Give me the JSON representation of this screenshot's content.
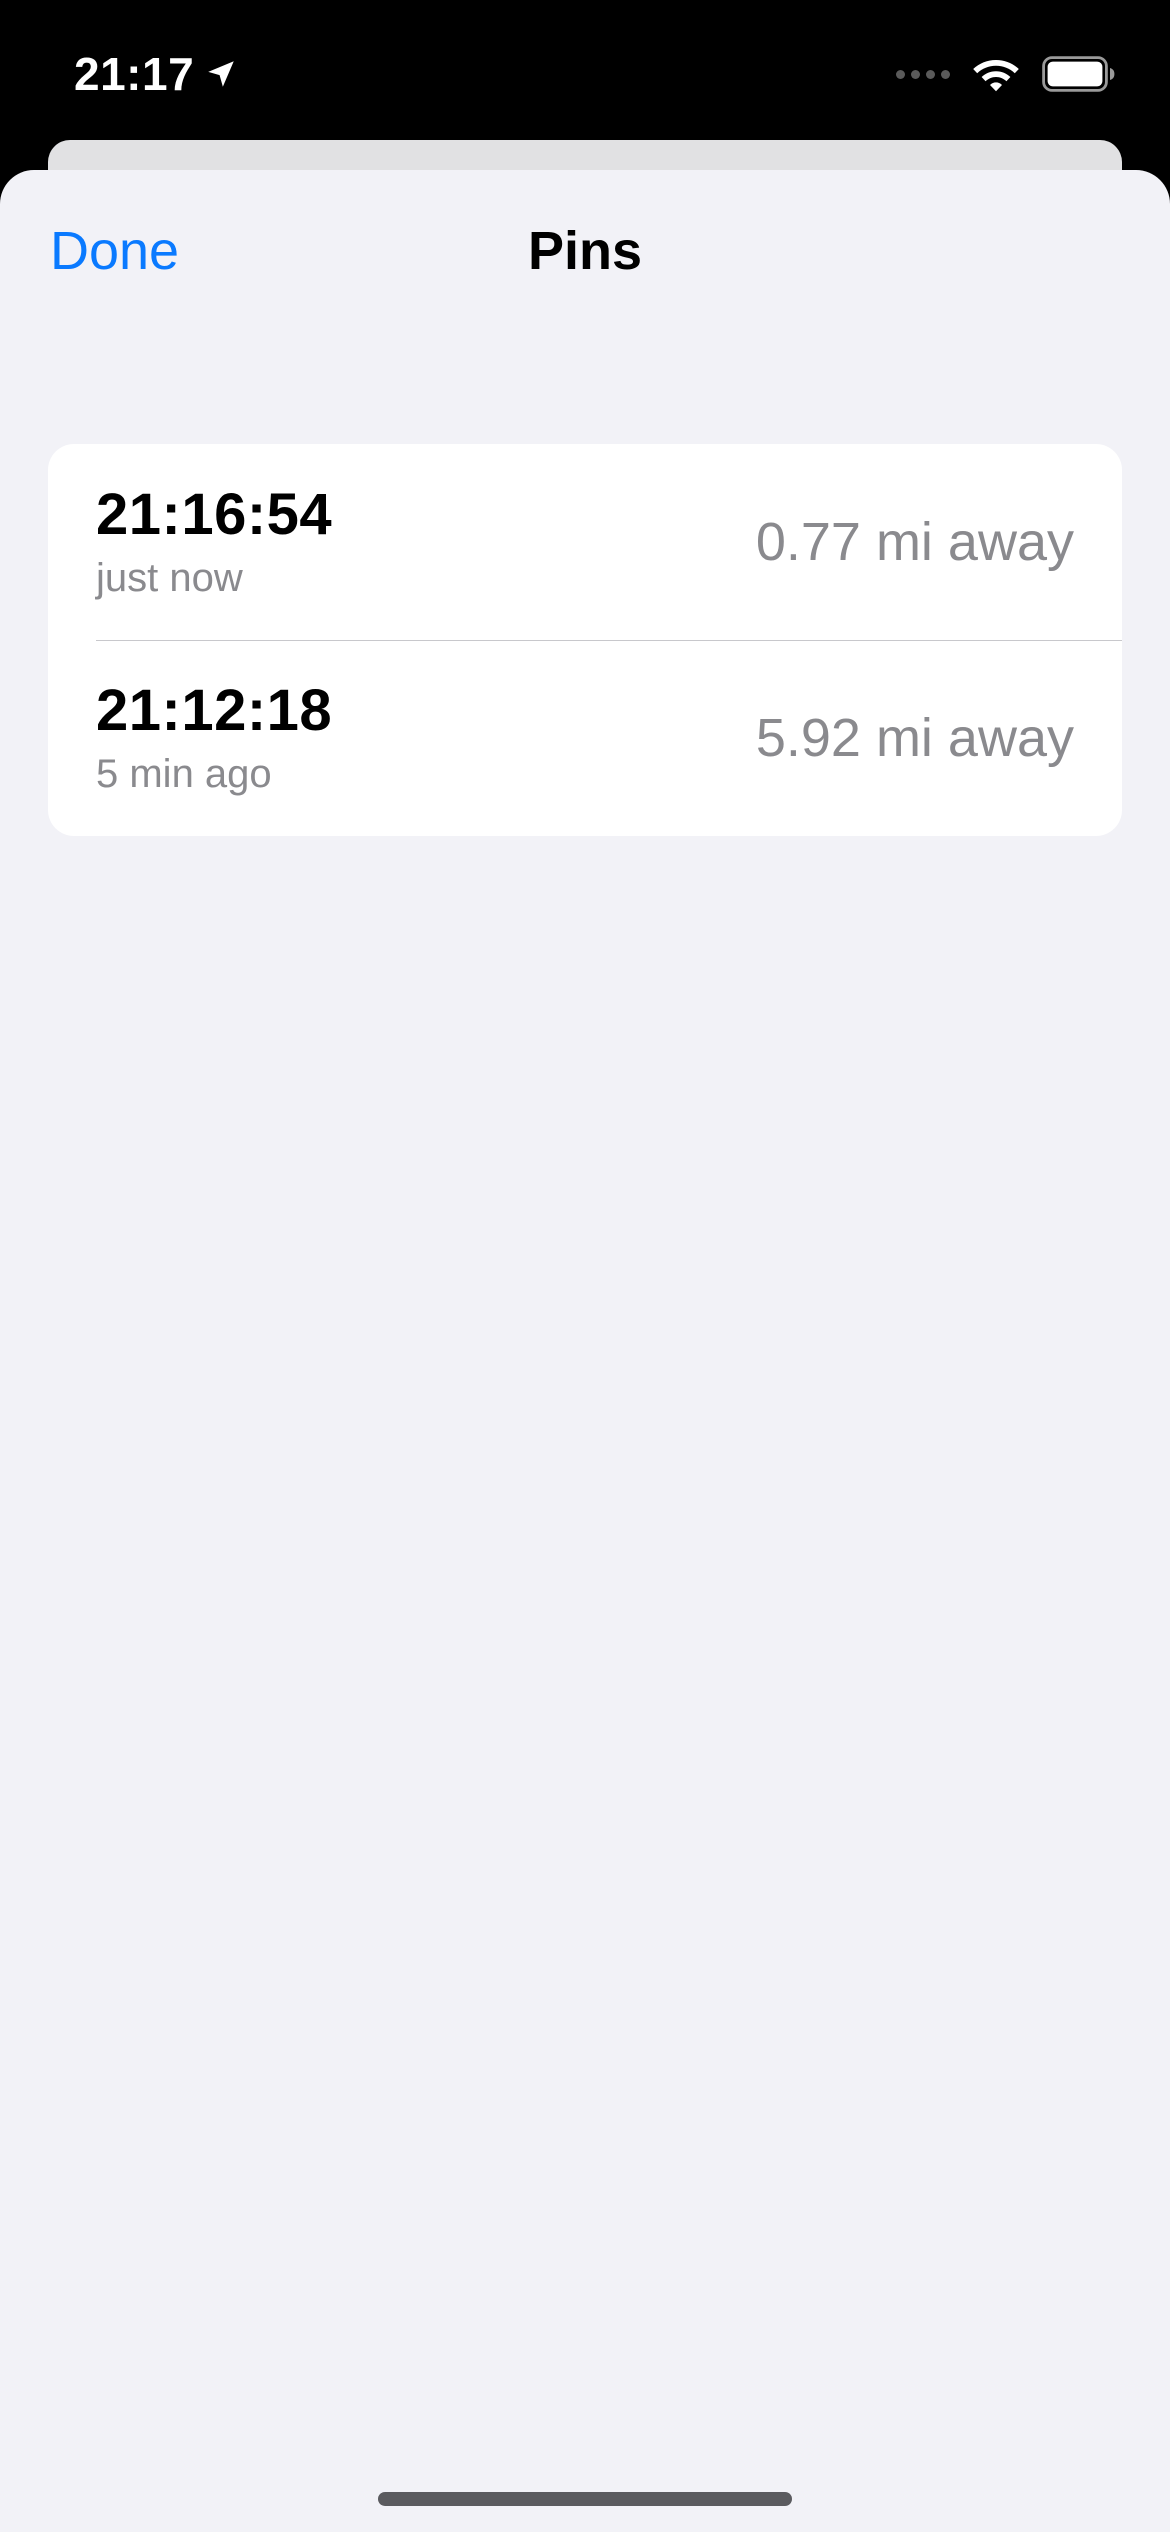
{
  "status_bar": {
    "time": "21:17",
    "icons": [
      "location-arrow-icon",
      "signal-dots-icon",
      "wifi-icon",
      "battery-icon"
    ]
  },
  "nav": {
    "done_label": "Done",
    "title": "Pins"
  },
  "pins": [
    {
      "time": "21:16:54",
      "relative": "just now",
      "distance": "0.77 mi away"
    },
    {
      "time": "21:12:18",
      "relative": "5 min ago",
      "distance": "5.92 mi away"
    }
  ],
  "colors": {
    "accent": "#0a7aff",
    "background": "#f2f2f7",
    "secondary_text": "#8a8a8e"
  }
}
